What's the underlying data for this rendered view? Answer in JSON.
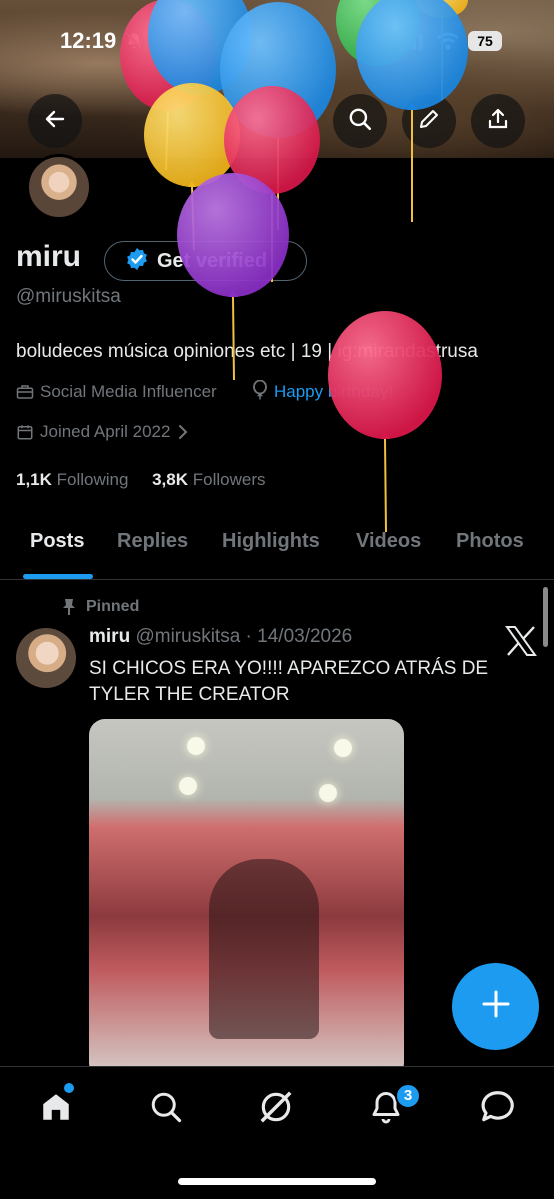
{
  "status_bar": {
    "time": "12:19",
    "battery": "75"
  },
  "profile": {
    "name": "miru",
    "verify_label": "Get verified",
    "handle": "@miruskitsa",
    "bio": "boludeces música opiniones etc | 19 | ig:mirandastrusa",
    "category": "Social Media Influencer",
    "birthday": "Happy birthday!",
    "joined": "Joined April 2022",
    "following_count": "1,1K",
    "following_label": "Following",
    "followers_count": "3,8K",
    "followers_label": "Followers"
  },
  "tabs": [
    {
      "label": "Posts",
      "active": true
    },
    {
      "label": "Replies",
      "active": false
    },
    {
      "label": "Highlights",
      "active": false
    },
    {
      "label": "Videos",
      "active": false
    },
    {
      "label": "Photos",
      "active": false
    }
  ],
  "pinned_post": {
    "pinned_label": "Pinned",
    "author": "miru",
    "meta": "@miruskitsa · 14/03/2026",
    "text": "SI CHICOS ERA YO!!!! APAREZCO ATRÁS DE TYLER THE CREATOR"
  },
  "bottom_nav": {
    "notification_count": "3"
  },
  "colors": {
    "accent": "#1d9bf0",
    "background": "#000000",
    "muted_text": "#71767b"
  },
  "icons": [
    "arrow-left-icon",
    "search-icon",
    "edit-icon",
    "share-icon",
    "verified-badge-icon",
    "briefcase-icon",
    "balloon-icon",
    "calendar-icon",
    "chevron-right-icon",
    "pin-icon",
    "x-logo-icon",
    "plus-icon",
    "home-icon",
    "grok-icon",
    "bell-icon",
    "mail-icon"
  ]
}
